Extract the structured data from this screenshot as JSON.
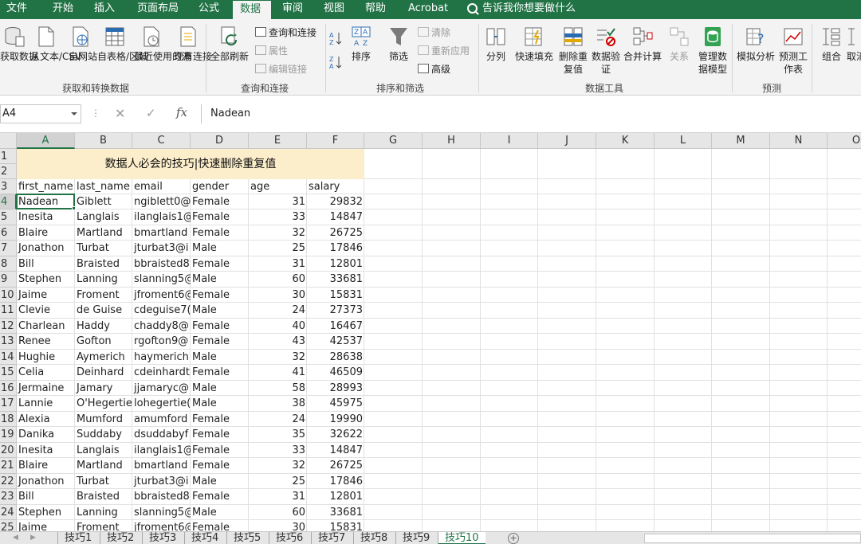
{
  "ribbon_tabs": [
    "文件",
    "开始",
    "插入",
    "页面布局",
    "公式",
    "数据",
    "审阅",
    "视图",
    "帮助",
    "Acrobat"
  ],
  "active_tab": "数据",
  "tell_me": "告诉我你想要做什么",
  "groups": {
    "get_data": {
      "label": "获取和转换数据",
      "buttons": [
        "获取数据",
        "从文本/CSV",
        "自网站",
        "自表格/区域",
        "最近使用的源",
        "现有连接"
      ]
    },
    "queries": {
      "label": "查询和连接",
      "refresh": "全部刷新",
      "small": [
        "查询和连接",
        "属性",
        "编辑链接"
      ]
    },
    "sort_filter": {
      "label": "排序和筛选",
      "sort": "排序",
      "filter": "筛选",
      "small": [
        "清除",
        "重新应用",
        "高级"
      ]
    },
    "data_tools": {
      "label": "数据工具",
      "buttons": [
        "分列",
        "快速填充",
        "删除重复值",
        "数据验证",
        "合并计算",
        "关系",
        "管理数据模型"
      ]
    },
    "forecast": {
      "label": "预测",
      "buttons": [
        "模拟分析",
        "预测工作表"
      ]
    },
    "outline": {
      "buttons": [
        "组合",
        "取消"
      ]
    }
  },
  "formula_bar": {
    "name_box": "A4",
    "formula": "Nadean"
  },
  "columns": [
    "A",
    "B",
    "C",
    "D",
    "E",
    "F",
    "G",
    "H",
    "I",
    "J",
    "K",
    "L",
    "M",
    "N",
    "O"
  ],
  "row_numbers": [
    "1",
    "2",
    "3",
    "4",
    "5",
    "6",
    "7",
    "8",
    "9",
    "10",
    "11",
    "12",
    "13",
    "14",
    "15",
    "16",
    "17",
    "18",
    "19",
    "20",
    "21",
    "22",
    "23",
    "24",
    "25"
  ],
  "sheet": {
    "title": "数据人必会的技巧|快速删除重复值",
    "headers": [
      "first_name",
      "last_name",
      "email",
      "gender",
      "age",
      "salary"
    ],
    "rows": [
      [
        "Nadean",
        "Giblett",
        "ngiblett0@",
        "Female",
        "31",
        "29832"
      ],
      [
        "Inesita",
        "Langlais",
        "ilanglais1@",
        "Female",
        "33",
        "14847"
      ],
      [
        "Blaire",
        "Martland",
        "bmartland",
        "Female",
        "32",
        "26725"
      ],
      [
        "Jonathon",
        "Turbat",
        "jturbat3@i",
        "Male",
        "25",
        "17846"
      ],
      [
        "Bill",
        "Braisted",
        "bbraisted8",
        "Female",
        "31",
        "12801"
      ],
      [
        "Stephen",
        "Lanning",
        "slanning5@",
        "Male",
        "60",
        "33681"
      ],
      [
        "Jaime",
        "Froment",
        "jfroment6@",
        "Female",
        "30",
        "15831"
      ],
      [
        "Clevie",
        "de Guise",
        "cdeguise7(",
        "Male",
        "24",
        "27373"
      ],
      [
        "Charlean",
        "Haddy",
        "chaddy8@",
        "Female",
        "40",
        "16467"
      ],
      [
        "Renee",
        "Gofton",
        "rgofton9@",
        "Female",
        "43",
        "42537"
      ],
      [
        "Hughie",
        "Aymerich",
        "haymerich",
        "Male",
        "32",
        "28638"
      ],
      [
        "Celia",
        "Deinhard",
        "cdeinhardt",
        "Female",
        "41",
        "46509"
      ],
      [
        "Jermaine",
        "Jamary",
        "jjamaryc@",
        "Male",
        "58",
        "28993"
      ],
      [
        "Lannie",
        "O'Hegertie",
        "lohegertie(",
        "Male",
        "38",
        "45975"
      ],
      [
        "Alexia",
        "Mumford",
        "amumford",
        "Female",
        "24",
        "19990"
      ],
      [
        "Danika",
        "Suddaby",
        "dsuddabyf",
        "Female",
        "35",
        "32622"
      ],
      [
        "Inesita",
        "Langlais",
        "ilanglais1@",
        "Female",
        "33",
        "14847"
      ],
      [
        "Blaire",
        "Martland",
        "bmartland",
        "Female",
        "32",
        "26725"
      ],
      [
        "Jonathon",
        "Turbat",
        "jturbat3@i",
        "Male",
        "25",
        "17846"
      ],
      [
        "Bill",
        "Braisted",
        "bbraisted8",
        "Female",
        "31",
        "12801"
      ],
      [
        "Stephen",
        "Lanning",
        "slanning5@",
        "Male",
        "60",
        "33681"
      ],
      [
        "Jaime",
        "Froment",
        "jfroment6@",
        "Female",
        "30",
        "15831"
      ]
    ]
  },
  "sheet_tabs": [
    "技巧1",
    "技巧2",
    "技巧3",
    "技巧4",
    "技巧5",
    "技巧6",
    "技巧7",
    "技巧8",
    "技巧9",
    "技巧10"
  ],
  "active_sheet": "技巧10",
  "colors": {
    "excel_green": "#217346",
    "title_fill": "#fdeecb"
  }
}
